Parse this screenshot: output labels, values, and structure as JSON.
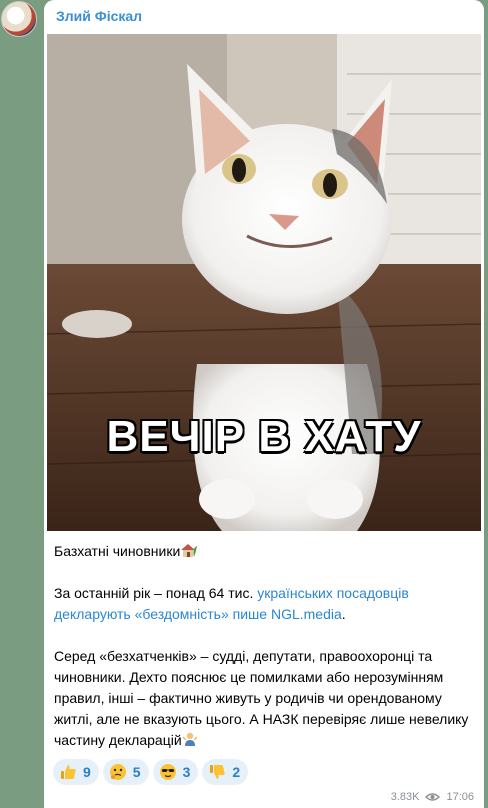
{
  "channel": {
    "name": "Злий Фіскал"
  },
  "post": {
    "image_caption": "ВЕЧІР В ХАТУ",
    "headline": "Базхатні чиновники",
    "p2_before": "За останній рік – понад 64 тис. ",
    "p2_link": "українських посадовців декларують «бездомність» пише NGL.media",
    "p2_after": ".",
    "p3": "Серед «безхатченків» – судді, депутати, правоохоронці та чиновники. Дехто пояснює це помилками або нерозумінням правил, інші – фактично живуть у родичів чи орендованому житлі, але не вказують цього. А НАЗК перевіряє лише невелику частину декларацій"
  },
  "reactions": [
    {
      "icon": "thumbs-up-icon",
      "count": "9"
    },
    {
      "icon": "thinking-face-icon",
      "count": "5"
    },
    {
      "icon": "sunglasses-face-icon",
      "count": "3"
    },
    {
      "icon": "thumbs-down-icon",
      "count": "2"
    }
  ],
  "meta": {
    "views": "3.83K",
    "time": "17:06"
  },
  "colors": {
    "accent": "#3a8fd6",
    "reaction_bg": "#e6f0f9",
    "background": "#7a9c80"
  }
}
